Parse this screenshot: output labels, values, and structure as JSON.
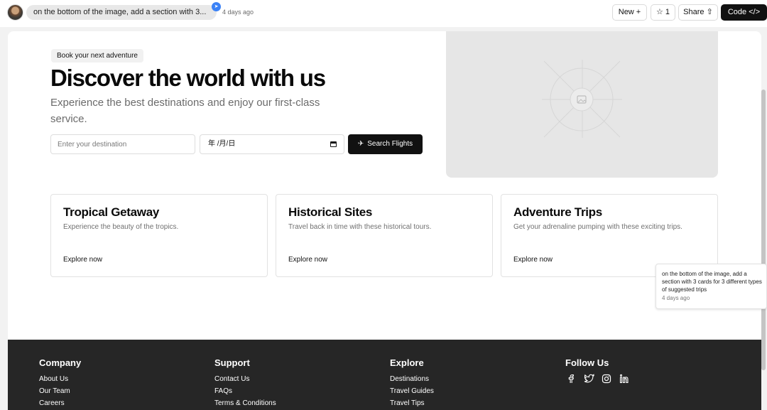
{
  "topbar": {
    "prompt_preview": "on the bottom of the image, add a section with 3...",
    "time_ago": "4 days ago",
    "new_label": "New +",
    "star_label": "☆ 1",
    "share_label": "Share ⇧",
    "code_label": "Code </>"
  },
  "hero": {
    "badge": "Book your next adventure",
    "title": "Discover the world with us",
    "subtitle": "Experience the best destinations and enjoy our first-class service.",
    "destination_placeholder": "Enter your destination",
    "date_value": "年 /月/日",
    "search_label": "Search Flights"
  },
  "cards": [
    {
      "title": "Tropical Getaway",
      "desc": "Experience the beauty of the tropics.",
      "link": "Explore now"
    },
    {
      "title": "Historical Sites",
      "desc": "Travel back in time with these historical tours.",
      "link": "Explore now"
    },
    {
      "title": "Adventure Trips",
      "desc": "Get your adrenaline pumping with these exciting trips.",
      "link": "Explore now"
    }
  ],
  "comment": {
    "text": "on the bottom of the image, add a section with 3 cards for 3 different types of suggested trips",
    "time": "4 days ago"
  },
  "footer": {
    "company": {
      "heading": "Company",
      "links": [
        "About Us",
        "Our Team",
        "Careers"
      ]
    },
    "support": {
      "heading": "Support",
      "links": [
        "Contact Us",
        "FAQs",
        "Terms & Conditions"
      ]
    },
    "explore": {
      "heading": "Explore",
      "links": [
        "Destinations",
        "Travel Guides",
        "Travel Tips"
      ]
    },
    "follow": {
      "heading": "Follow Us",
      "icons": [
        "facebook-icon",
        "twitter-icon",
        "instagram-icon",
        "linkedin-icon"
      ]
    }
  },
  "colors": {
    "accent": "#111111",
    "footer_bg": "#262626",
    "badge_blue": "#3b82f6"
  }
}
